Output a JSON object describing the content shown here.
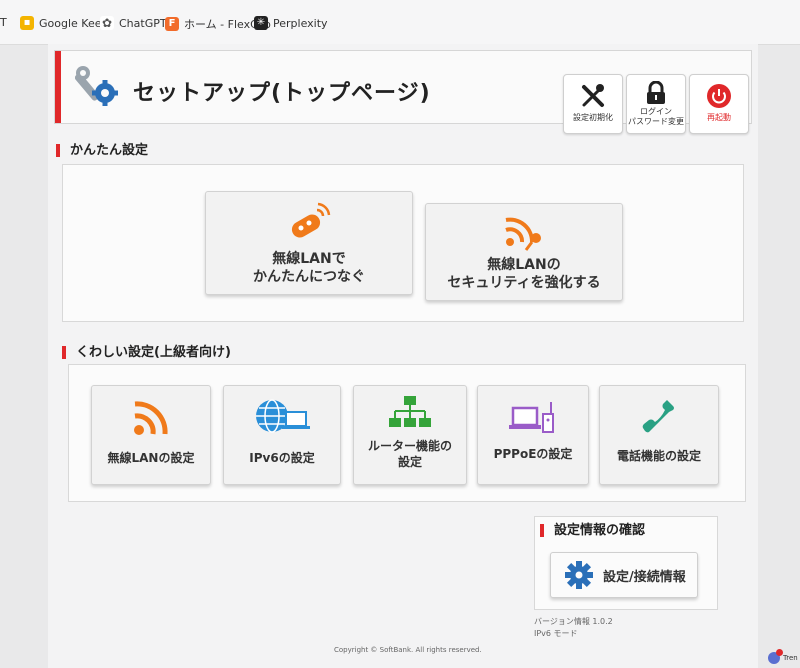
{
  "bookmarks": [
    {
      "label": "T",
      "icon": "bookmark-icon"
    },
    {
      "label": "Google Keep",
      "icon": "google-keep-icon",
      "color": "#f4b400"
    },
    {
      "label": "ChatGPT",
      "icon": "chatgpt-icon",
      "color": "#555555"
    },
    {
      "label": "ホーム - FlexClip",
      "icon": "flexclip-icon",
      "color": "#f26b2a"
    },
    {
      "label": "Perplexity",
      "icon": "perplexity-icon",
      "color": "#222222"
    }
  ],
  "header": {
    "title": "セットアップ(トップページ)",
    "buttons": {
      "reset": "設定初期化",
      "login_line1": "ログイン",
      "login_line2": "パスワード変更",
      "reboot": "再起動"
    }
  },
  "easy": {
    "title": "かんたん設定",
    "cards": [
      {
        "line1": "無線LANで",
        "line2": "かんたんにつなぐ",
        "icon": "wps-key-icon"
      },
      {
        "line1": "無線LANの",
        "line2": "セキュリティを強化する",
        "icon": "wifi-key-icon"
      }
    ]
  },
  "advanced": {
    "title": "くわしい設定(上級者向け)",
    "cards": [
      {
        "label": "無線LANの設定",
        "icon": "wifi-icon"
      },
      {
        "label": "IPv6の設定",
        "icon": "globe-laptop-icon"
      },
      {
        "label_line1": "ルーター機能の",
        "label_line2": "設定",
        "icon": "network-tree-icon"
      },
      {
        "label": "PPPoEの設定",
        "icon": "laptop-router-icon"
      },
      {
        "label": "電話機能の設定",
        "icon": "phone-icon"
      }
    ]
  },
  "info": {
    "title": "設定情報の確認",
    "button": "設定/接続情報",
    "version": "バージョン情報 1.0.2",
    "mode": "IPv6 モード"
  },
  "footer": {
    "copyright": "Copyright © SoftBank. All rights reserved."
  },
  "taskbar": {
    "text": "Tren"
  },
  "colors": {
    "accent_red": "#e0282a",
    "icon_orange": "#f07a1a",
    "icon_blue": "#2a8fd8",
    "icon_green": "#35a43a",
    "icon_purple": "#9a5cc8",
    "icon_teal": "#2aa184",
    "gear_blue": "#2a6fb8"
  }
}
